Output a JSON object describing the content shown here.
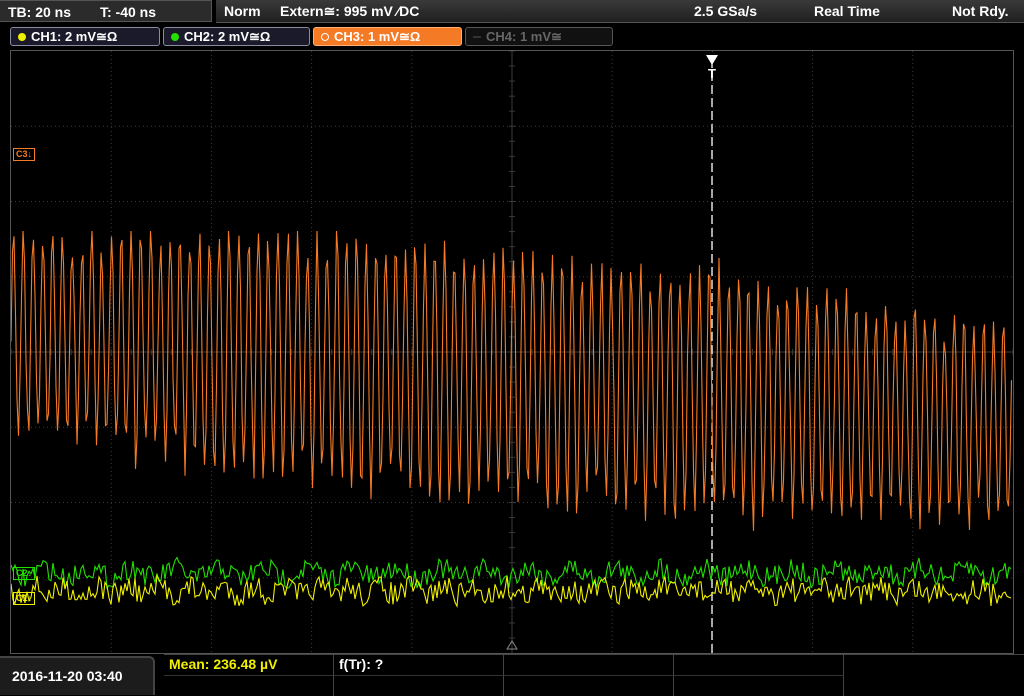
{
  "timebase": {
    "tb": "TB: 20 ns",
    "trigger_offset": "T: -40 ns"
  },
  "status": {
    "mode": "Norm",
    "trigger_source": "Extern≅: 995 mV ∕DC",
    "sample_rate": "2.5 GSa/s",
    "acquisition": "Real Time",
    "state": "Not Rdy."
  },
  "channels": [
    {
      "label": "CH1: 2 mV≅Ω",
      "color": "#f0f000",
      "active": true
    },
    {
      "label": "CH2: 2 mV≅Ω",
      "color": "#22e000",
      "active": true
    },
    {
      "label": "CH3: 1 mV≅Ω",
      "color": "#f57a25",
      "active": true,
      "selected": true
    },
    {
      "label": "CH4: 1 mV≅",
      "color": "#666666",
      "active": false
    }
  ],
  "markers": {
    "c3": "C3↓",
    "c2": "C2↓",
    "c1": "C1↓",
    "trigger": "T"
  },
  "colors": {
    "ch1": "#f0f000",
    "ch2": "#22e000",
    "ch3": "#f57a25",
    "grid": "#3a3a3a"
  },
  "datetime": "2016-11-20 03:40",
  "measurements": {
    "mean": "Mean: 236.48 µV",
    "ftr": "f(Tr): ?"
  }
}
